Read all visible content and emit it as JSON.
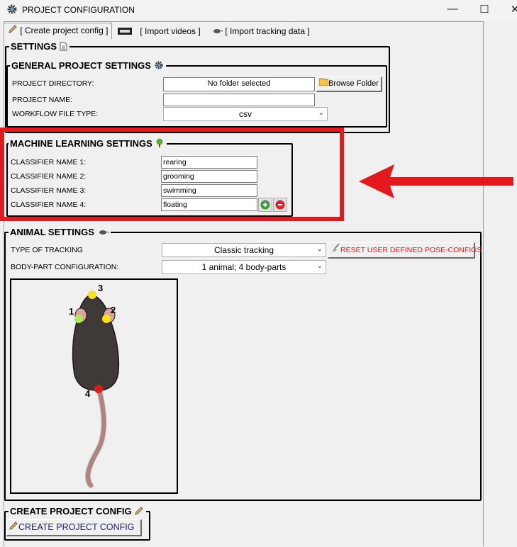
{
  "window": {
    "title": "PROJECT CONFIGURATION",
    "controls": {
      "minimize": "—",
      "maximize": "☐",
      "close": "✕"
    }
  },
  "tabs": [
    {
      "label": "[ Create project config ]",
      "active": true,
      "icon": "pencil-icon"
    },
    {
      "label": "[ Import videos ]",
      "active": false,
      "icon": "film-icon"
    },
    {
      "label": "[ Import tracking data ]",
      "active": false,
      "icon": "mouse-icon"
    }
  ],
  "settings": {
    "title": "SETTINGS",
    "general": {
      "title": "GENERAL PROJECT SETTINGS",
      "project_directory_label": "PROJECT DIRECTORY:",
      "project_directory_value": "No folder selected",
      "browse_button": "Browse Folder",
      "project_name_label": "PROJECT NAME:",
      "project_name_value": "",
      "workflow_label": "WORKFLOW FILE TYPE:",
      "workflow_value": "csv"
    }
  },
  "ml_settings": {
    "title": "MACHINE LEARNING SETTINGS",
    "classifiers": [
      {
        "label": "CLASSIFIER NAME 1:",
        "value": "rearing"
      },
      {
        "label": "CLASSIFIER NAME 2:",
        "value": "grooming"
      },
      {
        "label": "CLASSIFIER NAME 3:",
        "value": "swimming"
      },
      {
        "label": "CLASSIFIER NAME 4:",
        "value": "floating"
      }
    ]
  },
  "animal_settings": {
    "title": "ANIMAL SETTINGS",
    "tracking_label": "TYPE OF TRACKING",
    "tracking_value": "Classic tracking",
    "reset_button": "RESET USER DEFINED POSE-CONFIGS",
    "bodypart_label": "BODY-PART CONFIGURATION:",
    "bodypart_value": "1 animal; 4 body-parts",
    "bodypart_numbers": [
      "1",
      "2",
      "3",
      "4"
    ]
  },
  "create_config": {
    "title": "CREATE PROJECT CONFIG",
    "button": "CREATE PROJECT CONFIG"
  },
  "colors": {
    "highlight_box": "#e3191d",
    "arrow": "#e3191d",
    "reset_text": "#e3191d",
    "create_button_text": "#1a237e",
    "keypoint_yellow": "#f7e21b",
    "keypoint_green": "#b5e35a",
    "keypoint_red": "#e3191d"
  }
}
